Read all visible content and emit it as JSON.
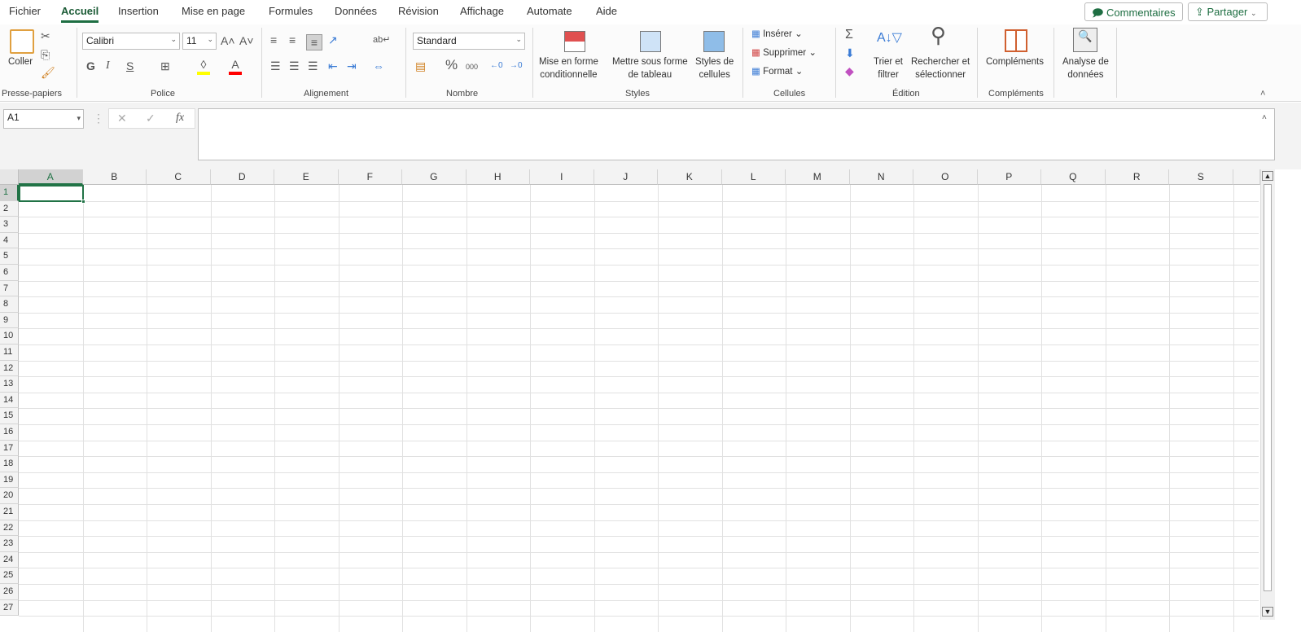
{
  "menu_tabs": [
    "Fichier",
    "Accueil",
    "Insertion",
    "Mise en page",
    "Formules",
    "Données",
    "Révision",
    "Affichage",
    "Automate",
    "Aide"
  ],
  "active_tab": "Accueil",
  "top_buttons": {
    "comments": "Commentaires",
    "share": "Partager"
  },
  "clipboard": {
    "paste": "Coller",
    "group": "Presse-papiers"
  },
  "font": {
    "name": "Calibri",
    "size": "11",
    "bold": "G",
    "italic": "I",
    "underline": "S",
    "group": "Police",
    "colors": {
      "highlight": "#ffff00",
      "font": "#ff0000"
    }
  },
  "alignment": {
    "group": "Alignement"
  },
  "number": {
    "format": "Standard",
    "percent": "%",
    "thousands": "000",
    "group": "Nombre"
  },
  "styles": {
    "conditional": [
      "Mise en forme",
      "conditionnelle"
    ],
    "table": [
      "Mettre sous forme",
      "de tableau"
    ],
    "cell_styles": [
      "Styles de",
      "cellules"
    ],
    "group": "Styles"
  },
  "cells": {
    "insert": "Insérer",
    "delete": "Supprimer",
    "format": "Format",
    "group": "Cellules"
  },
  "editing": {
    "sort": [
      "Trier et",
      "filtrer"
    ],
    "find": [
      "Rechercher et",
      "sélectionner"
    ],
    "group": "Édition"
  },
  "addins": {
    "label": "Compléments",
    "group": "Compléments"
  },
  "analysis": {
    "label": [
      "Analyse de",
      "données"
    ]
  },
  "formula_bar": {
    "name_box": "A1",
    "fx": "fx",
    "value": ""
  },
  "sheet": {
    "columns": [
      "A",
      "B",
      "C",
      "D",
      "E",
      "F",
      "G",
      "H",
      "I",
      "J",
      "K",
      "L",
      "M",
      "N",
      "O",
      "P",
      "Q",
      "R",
      "S"
    ],
    "rows": 27,
    "selected_cell": "A1",
    "accent": "#217346"
  }
}
